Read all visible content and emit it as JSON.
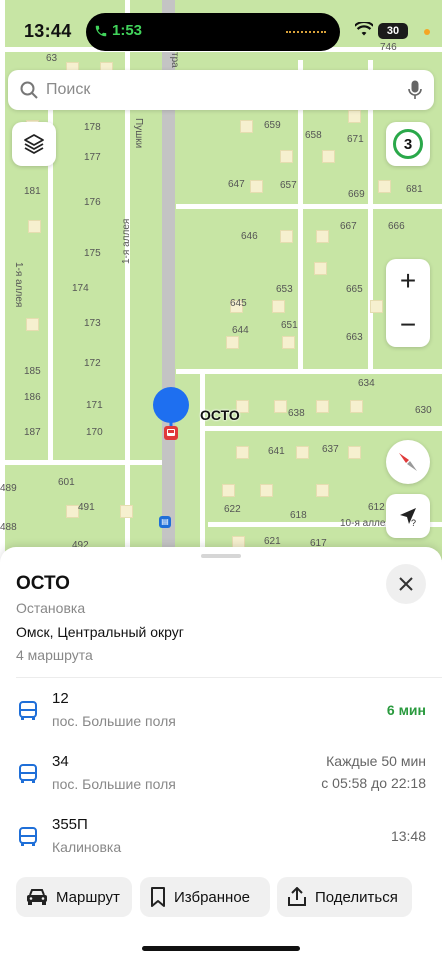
{
  "status_bar": {
    "time": "13:44",
    "call_time": "1:53",
    "battery": "30"
  },
  "search": {
    "placeholder": "Поиск"
  },
  "map": {
    "traffic_level": "3",
    "zoom_in": "+",
    "zoom_out": "−",
    "street_names": [
      "Пушки",
      "тра",
      "1-я аллея",
      "1-я аллея",
      "10-я аллея"
    ],
    "stop_label": "ОСТО",
    "house_numbers": [
      "746",
      "63",
      "178",
      "177",
      "181",
      "176",
      "175",
      "174",
      "173",
      "185",
      "172",
      "186",
      "171",
      "187",
      "170",
      "659",
      "658",
      "671",
      "647",
      "657",
      "669",
      "681",
      "646",
      "667",
      "666",
      "653",
      "665",
      "645",
      "644",
      "651",
      "663",
      "634",
      "638",
      "630",
      "641",
      "637",
      "622",
      "618",
      "612",
      "621",
      "617",
      "601",
      "491",
      "492",
      "489",
      "488"
    ]
  },
  "stop": {
    "name": "ОСТО",
    "type": "Остановка",
    "district": "Омск, Центральный округ",
    "route_count": "4 маршрута"
  },
  "routes": [
    {
      "number": "12",
      "destination": "пос. Большие поля",
      "eta": "6 мин",
      "eta_highlight": true
    },
    {
      "number": "34",
      "destination": "пос. Большие поля",
      "eta": "Каждые 50 мин",
      "eta_sub": "с 05:58 до 22:18"
    },
    {
      "number": "355П",
      "destination": "Калиновка",
      "eta": "13:48"
    }
  ],
  "actions": {
    "route": "Маршрут",
    "favorite": "Избранное",
    "share": "Поделиться"
  },
  "colors": {
    "map_green": "#c7e5a4",
    "accent_blue": "#1f6fd8",
    "pin_blue": "#1e6ff0",
    "eta_green": "#2a9a3e",
    "stop_red": "#e03a3a"
  }
}
